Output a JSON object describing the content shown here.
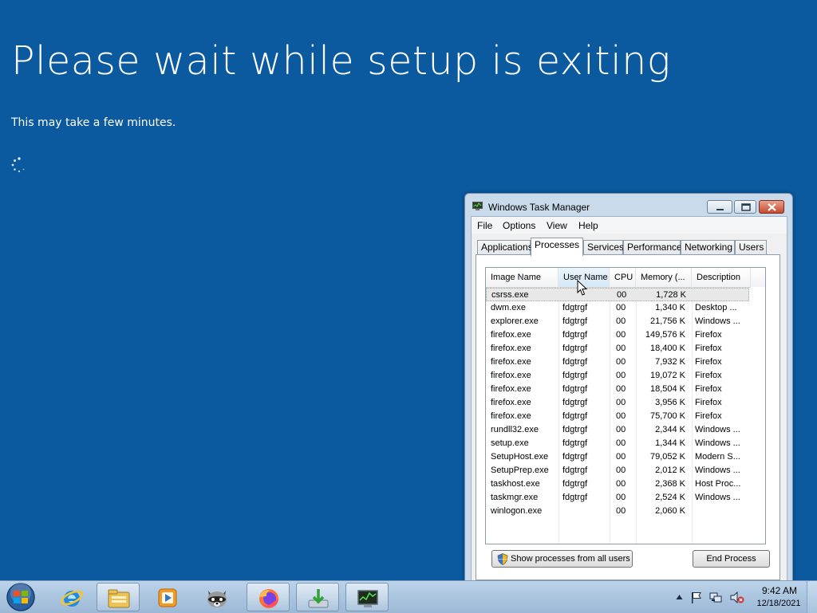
{
  "setup": {
    "title": "Please wait while setup is exiting",
    "subtitle": "This may take a few minutes."
  },
  "task_manager": {
    "title": "Windows Task Manager",
    "menu": [
      "File",
      "Options",
      "View",
      "Help"
    ],
    "tabs": [
      "Applications",
      "Processes",
      "Services",
      "Performance",
      "Networking",
      "Users"
    ],
    "active_tab": "Processes",
    "columns": [
      "Image Name",
      "User Name",
      "CPU",
      "Memory (...",
      "Description"
    ],
    "sorted_column": "Image Name",
    "rows": [
      {
        "name": "csrss.exe",
        "user": "",
        "cpu": "00",
        "mem": "1,728 K",
        "desc": ""
      },
      {
        "name": "dwm.exe",
        "user": "fdgtrgf",
        "cpu": "00",
        "mem": "1,340 K",
        "desc": "Desktop ..."
      },
      {
        "name": "explorer.exe",
        "user": "fdgtrgf",
        "cpu": "00",
        "mem": "21,756 K",
        "desc": "Windows ..."
      },
      {
        "name": "firefox.exe",
        "user": "fdgtrgf",
        "cpu": "00",
        "mem": "149,576 K",
        "desc": "Firefox"
      },
      {
        "name": "firefox.exe",
        "user": "fdgtrgf",
        "cpu": "00",
        "mem": "18,400 K",
        "desc": "Firefox"
      },
      {
        "name": "firefox.exe",
        "user": "fdgtrgf",
        "cpu": "00",
        "mem": "7,932 K",
        "desc": "Firefox"
      },
      {
        "name": "firefox.exe",
        "user": "fdgtrgf",
        "cpu": "00",
        "mem": "19,072 K",
        "desc": "Firefox"
      },
      {
        "name": "firefox.exe",
        "user": "fdgtrgf",
        "cpu": "00",
        "mem": "18,504 K",
        "desc": "Firefox"
      },
      {
        "name": "firefox.exe",
        "user": "fdgtrgf",
        "cpu": "00",
        "mem": "3,956 K",
        "desc": "Firefox"
      },
      {
        "name": "firefox.exe",
        "user": "fdgtrgf",
        "cpu": "00",
        "mem": "75,700 K",
        "desc": "Firefox"
      },
      {
        "name": "rundll32.exe",
        "user": "fdgtrgf",
        "cpu": "00",
        "mem": "2,344 K",
        "desc": "Windows ..."
      },
      {
        "name": "setup.exe",
        "user": "fdgtrgf",
        "cpu": "00",
        "mem": "1,344 K",
        "desc": "Windows ..."
      },
      {
        "name": "SetupHost.exe",
        "user": "fdgtrgf",
        "cpu": "00",
        "mem": "79,052 K",
        "desc": "Modern S..."
      },
      {
        "name": "SetupPrep.exe",
        "user": "fdgtrgf",
        "cpu": "00",
        "mem": "2,012 K",
        "desc": "Windows ..."
      },
      {
        "name": "taskhost.exe",
        "user": "fdgtrgf",
        "cpu": "00",
        "mem": "2,368 K",
        "desc": "Host Proc..."
      },
      {
        "name": "taskmgr.exe",
        "user": "fdgtrgf",
        "cpu": "00",
        "mem": "2,524 K",
        "desc": "Windows ..."
      },
      {
        "name": "winlogon.exe",
        "user": "",
        "cpu": "00",
        "mem": "2,060 K",
        "desc": ""
      }
    ],
    "selected_row": "csrss.exe",
    "show_all_label": "Show processes from all users",
    "end_process_label": "End Process"
  },
  "taskbar": {
    "pinned": [
      "start-orb",
      "internet-explorer-icon",
      "file-explorer-icon",
      "media-player-icon",
      "raccoon-app-icon",
      "firefox-icon",
      "installer-icon",
      "task-manager-icon"
    ],
    "clock_time": "9:42 AM",
    "clock_date": "12/18/2021"
  },
  "colors": {
    "setup_background": "#0b5aa0",
    "taskbar": "#aac4df"
  }
}
